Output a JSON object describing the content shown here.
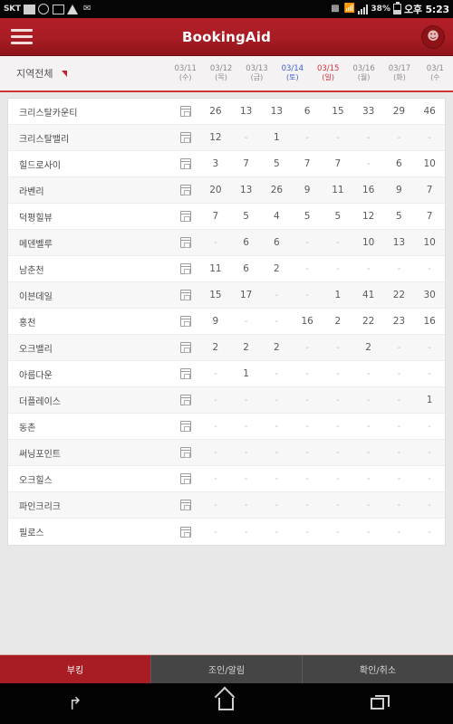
{
  "status_bar": {
    "carrier": "SKT",
    "left_icons": [
      "screenshot-icon",
      "sync-icon",
      "app-update-icon",
      "warning-icon",
      "mail-icon"
    ],
    "right_icons": [
      "no-sim-icon",
      "wifi-icon",
      "signal-icon"
    ],
    "battery_percent": "38%",
    "time": "오후 5:23"
  },
  "app_bar": {
    "title": "BookingAid",
    "menu_icon": "hamburger-icon",
    "profile_icon": "avatar-icon"
  },
  "filter": {
    "region_label": "지역전체",
    "caret_icon": "caret-down-icon"
  },
  "date_columns": [
    {
      "date": "03/11",
      "dow": "(수)",
      "kind": "weekday"
    },
    {
      "date": "03/12",
      "dow": "(목)",
      "kind": "weekday"
    },
    {
      "date": "03/13",
      "dow": "(금)",
      "kind": "weekday"
    },
    {
      "date": "03/14",
      "dow": "(토)",
      "kind": "sat"
    },
    {
      "date": "03/15",
      "dow": "(일)",
      "kind": "sun"
    },
    {
      "date": "03/16",
      "dow": "(월)",
      "kind": "weekday"
    },
    {
      "date": "03/17",
      "dow": "(화)",
      "kind": "weekday"
    },
    {
      "date": "03/1",
      "dow": "(수",
      "kind": "weekday"
    }
  ],
  "table": {
    "rows": [
      {
        "name": "크리스탈카운티",
        "icon": "calendar-icon",
        "values": [
          "26",
          "13",
          "13",
          "6",
          "15",
          "33",
          "29",
          "46"
        ]
      },
      {
        "name": "크리스탈밸리",
        "icon": "calendar-icon",
        "values": [
          "12",
          "-",
          "1",
          "-",
          "-",
          "-",
          "-",
          "-"
        ]
      },
      {
        "name": "힐드로사이",
        "icon": "calendar-icon",
        "values": [
          "3",
          "7",
          "5",
          "7",
          "7",
          "-",
          "6",
          "10"
        ]
      },
      {
        "name": "라벤리",
        "icon": "calendar-icon",
        "values": [
          "20",
          "13",
          "26",
          "9",
          "11",
          "16",
          "9",
          "7"
        ]
      },
      {
        "name": "덕평힐뷰",
        "icon": "calendar-icon",
        "values": [
          "7",
          "5",
          "4",
          "5",
          "5",
          "12",
          "5",
          "7"
        ]
      },
      {
        "name": "메덴벨루",
        "icon": "calendar-icon",
        "values": [
          "-",
          "6",
          "6",
          "-",
          "-",
          "10",
          "13",
          "10"
        ]
      },
      {
        "name": "남춘천",
        "icon": "calendar-icon",
        "values": [
          "11",
          "6",
          "2",
          "-",
          "-",
          "-",
          "-",
          "-"
        ]
      },
      {
        "name": "이븐데일",
        "icon": "calendar-icon",
        "values": [
          "15",
          "17",
          "-",
          "-",
          "1",
          "41",
          "22",
          "30"
        ]
      },
      {
        "name": "홍천",
        "icon": "calendar-icon",
        "values": [
          "9",
          "-",
          "-",
          "16",
          "2",
          "22",
          "23",
          "16"
        ]
      },
      {
        "name": "오크밸리",
        "icon": "calendar-icon",
        "values": [
          "2",
          "2",
          "2",
          "-",
          "-",
          "2",
          "-",
          "-"
        ]
      },
      {
        "name": "아름다운",
        "icon": "calendar-icon",
        "values": [
          "-",
          "1",
          "-",
          "-",
          "-",
          "-",
          "-",
          "-"
        ]
      },
      {
        "name": "더플레이스",
        "icon": "calendar-icon",
        "values": [
          "-",
          "-",
          "-",
          "-",
          "-",
          "-",
          "-",
          "1"
        ]
      },
      {
        "name": "동촌",
        "icon": "calendar-icon",
        "values": [
          "-",
          "-",
          "-",
          "-",
          "-",
          "-",
          "-",
          "-"
        ]
      },
      {
        "name": "써닝포인트",
        "icon": "calendar-icon",
        "values": [
          "-",
          "-",
          "-",
          "-",
          "-",
          "-",
          "-",
          "-"
        ]
      },
      {
        "name": "오크힐스",
        "icon": "calendar-icon",
        "values": [
          "-",
          "-",
          "-",
          "-",
          "-",
          "-",
          "-",
          "-"
        ]
      },
      {
        "name": "파인크리크",
        "icon": "calendar-icon",
        "values": [
          "-",
          "-",
          "-",
          "-",
          "-",
          "-",
          "-",
          "-"
        ]
      },
      {
        "name": "필로스",
        "icon": "calendar-icon",
        "values": [
          "-",
          "-",
          "-",
          "-",
          "-",
          "-",
          "-",
          "-"
        ]
      }
    ]
  },
  "bottom_tabs": [
    {
      "label": "부킹",
      "active": true
    },
    {
      "label": "조인/알림",
      "active": false
    },
    {
      "label": "확인/취소",
      "active": false
    }
  ],
  "nav_bar": {
    "back": "back-icon",
    "home": "home-icon",
    "recents": "recents-icon"
  },
  "colors": {
    "brand_red": "#a81c24",
    "accent_red": "#c0272d",
    "saturday_blue": "#3a5fcd",
    "sunday_red": "#d62f38"
  }
}
